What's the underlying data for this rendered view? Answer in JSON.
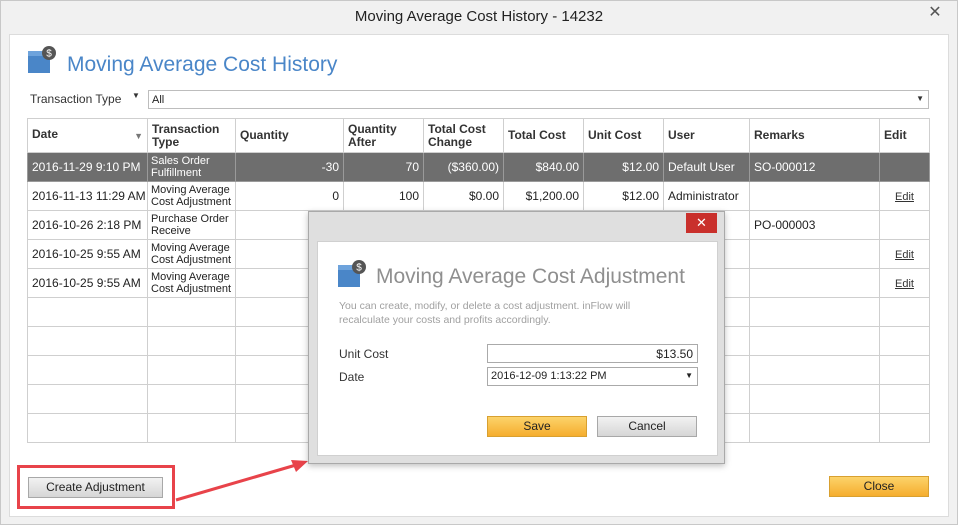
{
  "window": {
    "title": "Moving Average Cost History - 14232",
    "close_glyph": "✕"
  },
  "header": {
    "title": "Moving Average Cost History",
    "icon": "inventory-box-dollar-icon"
  },
  "filter": {
    "label": "Transaction Type",
    "value": "All"
  },
  "table": {
    "columns": [
      "Date",
      "Transaction Type",
      "Quantity",
      "Quantity After",
      "Total Cost Change",
      "Total Cost",
      "Unit Cost",
      "User",
      "Remarks",
      "Edit"
    ],
    "rows": [
      {
        "date": "2016-11-29 9:10 PM",
        "type": "Sales Order Fulfillment",
        "quantity": "-30",
        "quantity_after": "70",
        "total_cost_change": "($360.00)",
        "total_cost": "$840.00",
        "unit_cost": "$12.00",
        "user": "Default User",
        "remarks": "SO-000012",
        "edit": ""
      },
      {
        "date": "2016-11-13 11:29 AM",
        "type": "Moving Average Cost Adjustment",
        "quantity": "0",
        "quantity_after": "100",
        "total_cost_change": "$0.00",
        "total_cost": "$1,200.00",
        "unit_cost": "$12.00",
        "user": "Administrator",
        "remarks": "",
        "edit": "Edit"
      },
      {
        "date": "2016-10-26 2:18 PM",
        "type": "Purchase Order Receive",
        "quantity": "",
        "quantity_after": "",
        "total_cost_change": "",
        "total_cost": "",
        "unit_cost": "",
        "user": "",
        "remarks": "PO-000003",
        "edit": ""
      },
      {
        "date": "2016-10-25 9:55 AM",
        "type": "Moving Average Cost Adjustment",
        "quantity": "",
        "quantity_after": "",
        "total_cost_change": "",
        "total_cost": "",
        "unit_cost": "",
        "user": "",
        "remarks": "",
        "edit": "Edit"
      },
      {
        "date": "2016-10-25 9:55 AM",
        "type": "Moving Average Cost Adjustment",
        "quantity": "",
        "quantity_after": "",
        "total_cost_change": "",
        "total_cost": "",
        "unit_cost": "",
        "user": "",
        "remarks": "",
        "edit": "Edit"
      }
    ]
  },
  "buttons": {
    "create": "Create Adjustment",
    "close": "Close"
  },
  "dialog": {
    "close_glyph": "✕",
    "title": "Moving Average Cost Adjustment",
    "description": "You can create, modify, or delete a cost adjustment.  inFlow will recalculate your costs and profits accordingly.",
    "unit_cost_label": "Unit Cost",
    "unit_cost_value": "$13.50",
    "date_label": "Date",
    "date_value": "2016-12-09 1:13:22 PM",
    "save_label": "Save",
    "cancel_label": "Cancel"
  },
  "colors": {
    "accent_blue": "#4a86c8",
    "highlight_red": "#e8434a",
    "button_orange": "#f5ad2e",
    "selected_row": "#6e6e6e"
  }
}
